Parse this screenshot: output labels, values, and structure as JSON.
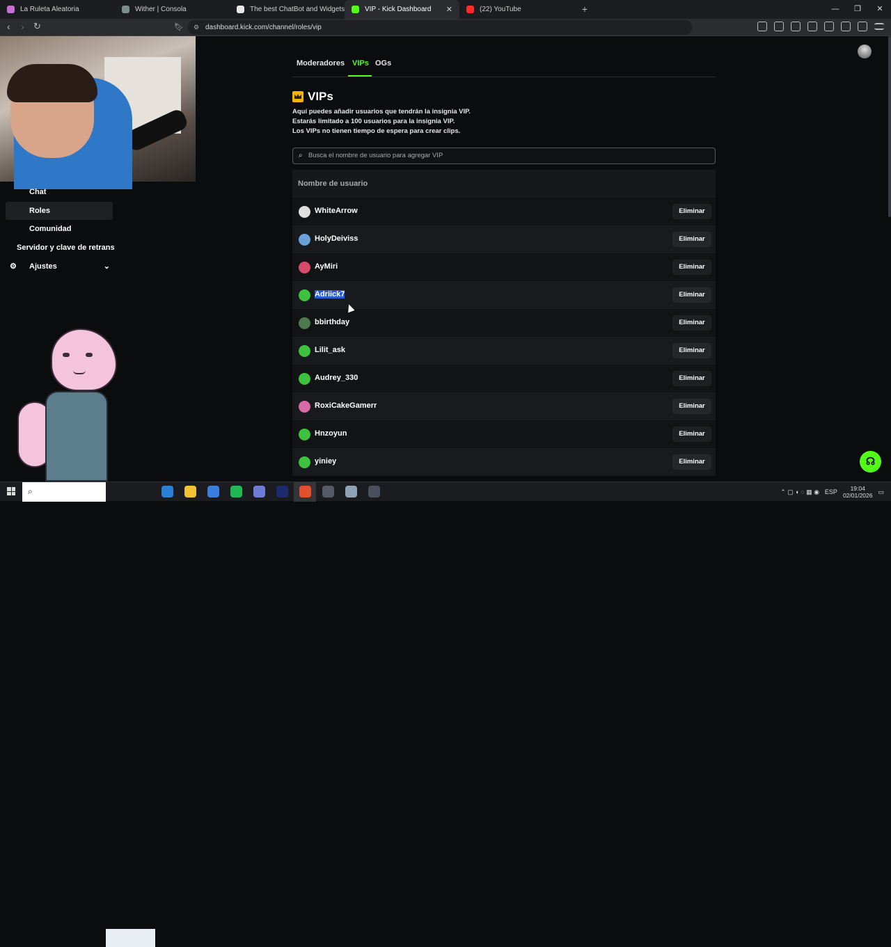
{
  "browser": {
    "tabs": [
      {
        "label": "La Ruleta Aleatoria",
        "color": "#c86fd6",
        "active": false
      },
      {
        "label": "Wither | Consola",
        "color": "#7a8f8a",
        "active": false
      },
      {
        "label": "The best ChatBot and Widgets for Ki",
        "color": "#e8e8e8",
        "active": false
      },
      {
        "label": "VIP - Kick Dashboard",
        "color": "#53fc18",
        "active": true,
        "close": "✕"
      },
      {
        "label": "(22) YouTube",
        "color": "#ff2a2a",
        "active": false
      }
    ],
    "new_tab": "+",
    "window_controls": {
      "minimize": "—",
      "maximize": "❐",
      "close": "✕"
    },
    "nav": {
      "back": "‹",
      "forward": "›",
      "reload": "↻"
    },
    "url": "dashboard.kick.com/channel/roles/vip",
    "url_icon": "⚙"
  },
  "sidebar": {
    "items": [
      {
        "label": "Chat",
        "selected": false
      },
      {
        "label": "Roles",
        "selected": true
      },
      {
        "label": "Comunidad",
        "selected": false
      }
    ],
    "server_key": "Servidor y clave de retrans",
    "settings_icon": "⚙",
    "settings": "Ajustes",
    "settings_chevron": "⌄"
  },
  "main": {
    "tabs": [
      {
        "label": "Moderadores",
        "active": false
      },
      {
        "label": "VIPs",
        "active": true
      },
      {
        "label": "OGs",
        "active": false
      }
    ],
    "title": "VIPs",
    "description": [
      "Aquí puedes añadir usuarios que tendrán la insignia VIP.",
      "Estarás limitado a 100 usuarios para la insignia VIP.",
      "Los VIPs no tienen tiempo de espera para crear clips."
    ],
    "search_icon": "⌕",
    "search_placeholder": "Busca el nombre de usuario para agregar VIP",
    "table_header": "Nombre de usuario",
    "remove_label": "Eliminar",
    "users": [
      {
        "name": "WhiteArrow",
        "avatar": "#dedede"
      },
      {
        "name": "HolyDeiviss",
        "avatar": "#6aa0d8"
      },
      {
        "name": "AyMiri",
        "avatar": "#d84a6a"
      },
      {
        "name": "Adriick7",
        "avatar": "#3ec23e",
        "highlighted": true
      },
      {
        "name": "bbirthday",
        "avatar": "#4d7a4d"
      },
      {
        "name": "Lilit_ask",
        "avatar": "#3ec23e"
      },
      {
        "name": "Audrey_330",
        "avatar": "#3ec23e"
      },
      {
        "name": "RoxiCakeGamerr",
        "avatar": "#d86aa8"
      },
      {
        "name": "Hnzoyun",
        "avatar": "#3ec23e"
      },
      {
        "name": "yiniey",
        "avatar": "#3ec23e"
      }
    ]
  },
  "help_icon": "☊",
  "taskbar": {
    "search_icon": "⌕",
    "apps": [
      "#2b7fd6",
      "#f2c230",
      "#3a7de0",
      "#1db954",
      "#6e7bd9",
      "#1e2a6e",
      "#e2502c",
      "#555a66",
      "#8ea3b8",
      "#4a4f5c"
    ],
    "tray_icons": "⌃  ▢  ◖  ◌  ▦  ◉",
    "lang": "ESP",
    "time": "19:04",
    "date": "02/01/2026",
    "notif": "▭"
  }
}
